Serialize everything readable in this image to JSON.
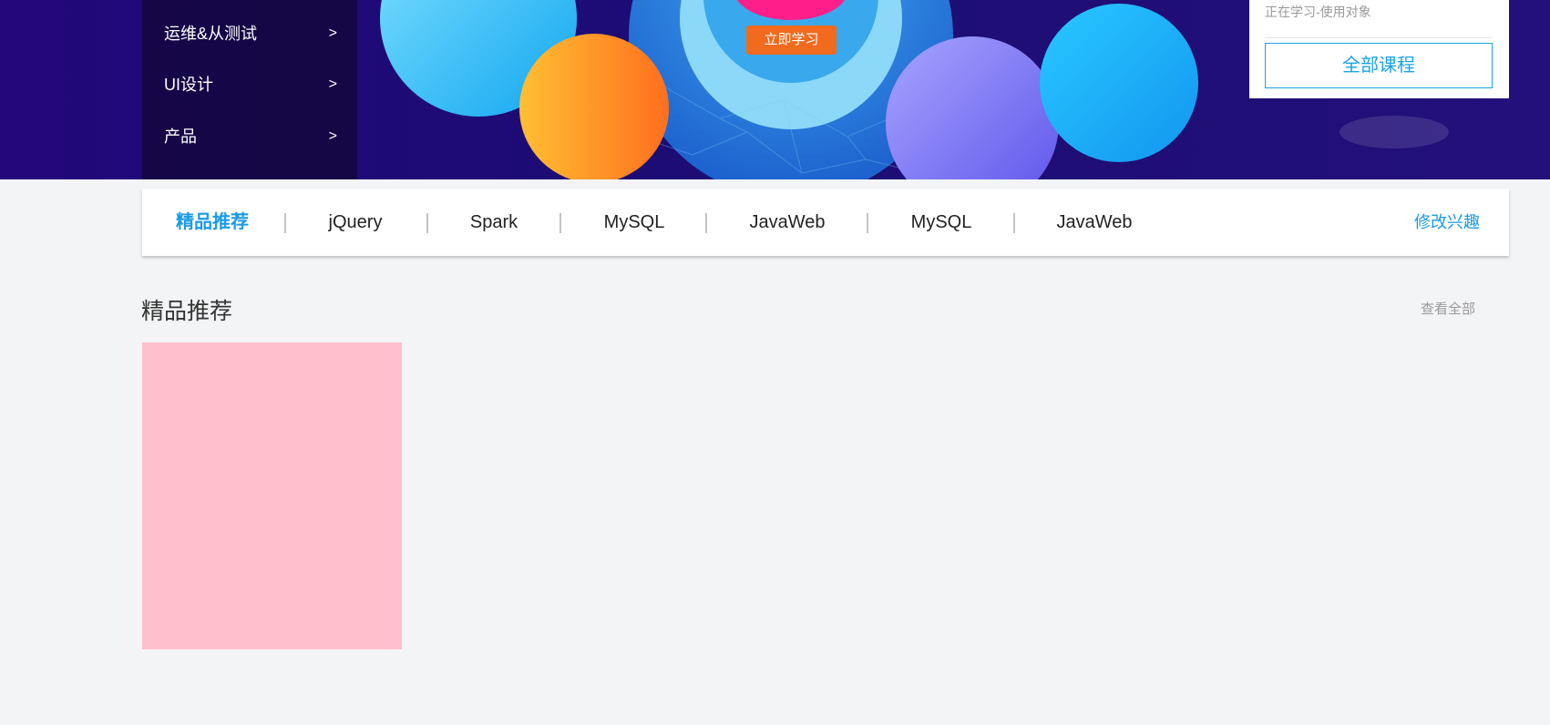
{
  "banner": {
    "categories": [
      {
        "label": "运维&从测试",
        "arrow": ">"
      },
      {
        "label": "UI设计",
        "arrow": ">"
      },
      {
        "label": "产品",
        "arrow": ">"
      }
    ],
    "cta_label": "立即学习",
    "colors": {
      "background": "#1e0a6e",
      "cta": "#f16a1e"
    }
  },
  "user_card": {
    "subtitle": "正在学习-使用对象",
    "all_courses_label": "全部课程"
  },
  "interest_tabs": {
    "items": [
      "精品推荐",
      "jQuery",
      "Spark",
      "MySQL",
      "JavaWeb",
      "MySQL",
      "JavaWeb"
    ],
    "active_index": 0,
    "edit_label": "修改兴趣",
    "accent_color": "#1a9be6"
  },
  "section": {
    "title": "精品推荐",
    "view_all_label": "查看全部"
  }
}
